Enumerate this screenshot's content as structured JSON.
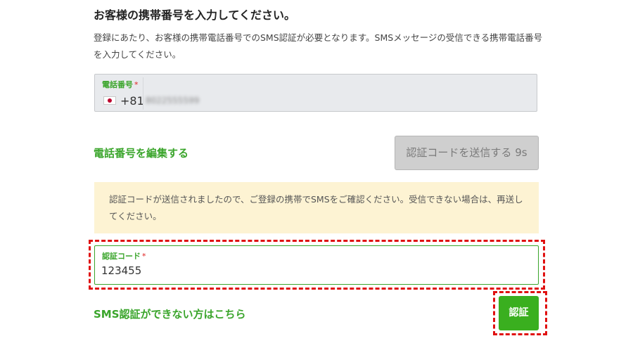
{
  "page": {
    "heading": "お客様の携帯番号を入力してください。",
    "description": "登録にあたり、お客様の携帯電話番号でのSMS認証が必要となります。SMSメッセージの受信できる携帯電話番号を入力してください。"
  },
  "phone_field": {
    "label": "電話番号",
    "required_mark": "*",
    "country_flag": "japan-flag-icon",
    "country_code": "+81",
    "value": "8022555599"
  },
  "actions": {
    "edit_phone_link": "電話番号を編集する",
    "send_code_button": "認証コードを送信する 9s"
  },
  "notice": {
    "text": "認証コードが送信されましたので、ご登録の携帯でSMSをご確認ください。受信できない場合は、再送してください。"
  },
  "code_field": {
    "label": "認証コード",
    "required_mark": "*",
    "value": "123455"
  },
  "footer": {
    "sms_help_link": "SMS認証ができない方はこちら",
    "verify_button": "認証"
  },
  "colors": {
    "accent_green": "#3aa52b",
    "verify_button_bg": "#3aaf1f",
    "disabled_button_bg": "#cfcfcf",
    "notice_bg": "#fdf3d3",
    "highlight_red": "#e01010",
    "required_red": "#e02020"
  }
}
